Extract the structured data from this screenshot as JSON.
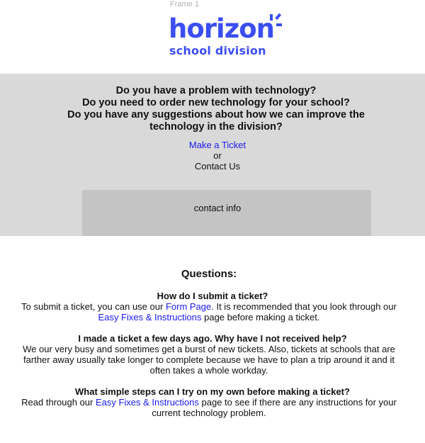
{
  "frame_label": "Frame 1",
  "logo": {
    "wordmark": "horizon",
    "subtitle": "school division",
    "color": "#3b4ef2"
  },
  "hero": {
    "questions": [
      "Do you have a problem with technology?",
      "Do you need to order new technology for your school?",
      "Do you have any suggestions about how we can improve the technology in the division?"
    ],
    "make_ticket": "Make a Ticket",
    "or": "or",
    "contact_us": "Contact Us",
    "contact_info": "contact info",
    "background": "#d9d9d9",
    "contact_box_background": "#c4c4c4",
    "link_color": "#1a1aee"
  },
  "faq": {
    "heading": "Questions:",
    "items": [
      {
        "question": "How do I submit a ticket?",
        "answer_before": "To submit a ticket, you can use our ",
        "link1": "Form Page",
        "answer_middle": ". It is recommended that you look through our ",
        "link2": "Easy Fixes & Instructions",
        "answer_after": " page before making a ticket."
      },
      {
        "question": "I made a ticket a few days ago. Why have I not received help?",
        "answer": "We our very busy and sometimes get a burst of new tickets. Also, tickets at schools that are farther away usually take longer to complete because we have to plan a trip around it and it often takes a whole workday."
      },
      {
        "question": "What simple steps can I try on my own before making a ticket?",
        "answer_before": "Read through our ",
        "link": "Easy Fixes & Instructions",
        "answer_after": " page to see if there are any instructions for your current technology problem."
      }
    ]
  }
}
